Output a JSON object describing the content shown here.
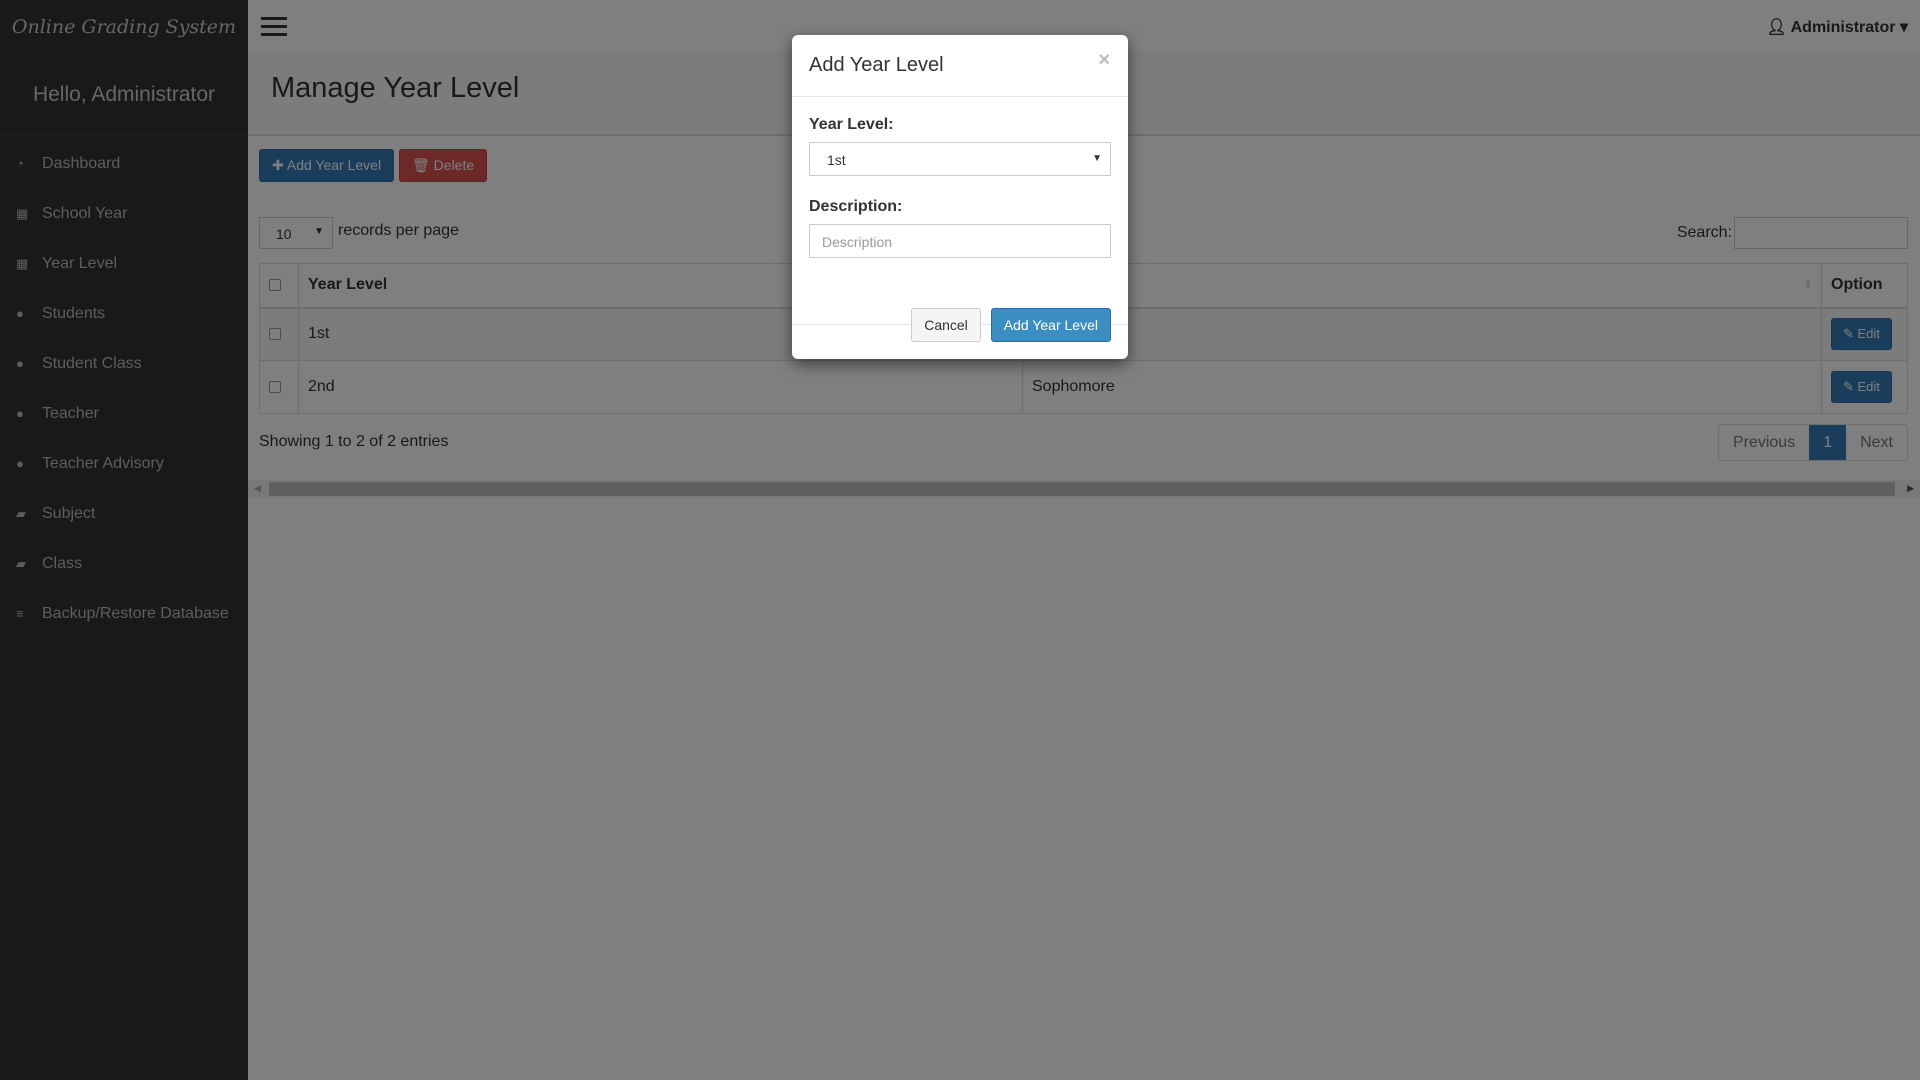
{
  "app": {
    "title": "Online Grading System",
    "greeting": "Hello, Administrator",
    "user": "Administrator"
  },
  "sidebar": {
    "items": [
      {
        "label": "Dashboard",
        "icon": "dashboard-icon",
        "glyph": "◔"
      },
      {
        "label": "School Year",
        "icon": "calendar-icon",
        "glyph": "▦"
      },
      {
        "label": "Year Level",
        "icon": "calendar-icon",
        "glyph": "▦"
      },
      {
        "label": "Students",
        "icon": "user-icon",
        "glyph": "●"
      },
      {
        "label": "Student Class",
        "icon": "user-icon",
        "glyph": "●"
      },
      {
        "label": "Teacher",
        "icon": "user-icon",
        "glyph": "●"
      },
      {
        "label": "Teacher Advisory",
        "icon": "user-icon",
        "glyph": "●"
      },
      {
        "label": "Subject",
        "icon": "book-icon",
        "glyph": "▰"
      },
      {
        "label": "Class",
        "icon": "book-icon",
        "glyph": "▰"
      },
      {
        "label": "Backup/Restore Database",
        "icon": "database-icon",
        "glyph": "≡"
      }
    ]
  },
  "page": {
    "title": "Manage Year Level",
    "add_label": "Add Year Level",
    "delete_label": "Delete",
    "length_value": "10",
    "length_label": "records per page",
    "search_label": "Search:",
    "columns": [
      "Year Level",
      "Option"
    ],
    "rows": [
      {
        "level": "1st",
        "description": "",
        "edit": "Edit"
      },
      {
        "level": "2nd",
        "description": "Sophomore",
        "edit": "Edit"
      }
    ],
    "info": "Showing 1 to 2 of 2 entries",
    "prev": "Previous",
    "page": "1",
    "next": "Next"
  },
  "modal": {
    "title": "Add Year Level",
    "close": "×",
    "level_label": "Year Level:",
    "level_value": "1st",
    "desc_label": "Description:",
    "desc_placeholder": "Description",
    "cancel": "Cancel",
    "submit": "Add Year Level"
  }
}
